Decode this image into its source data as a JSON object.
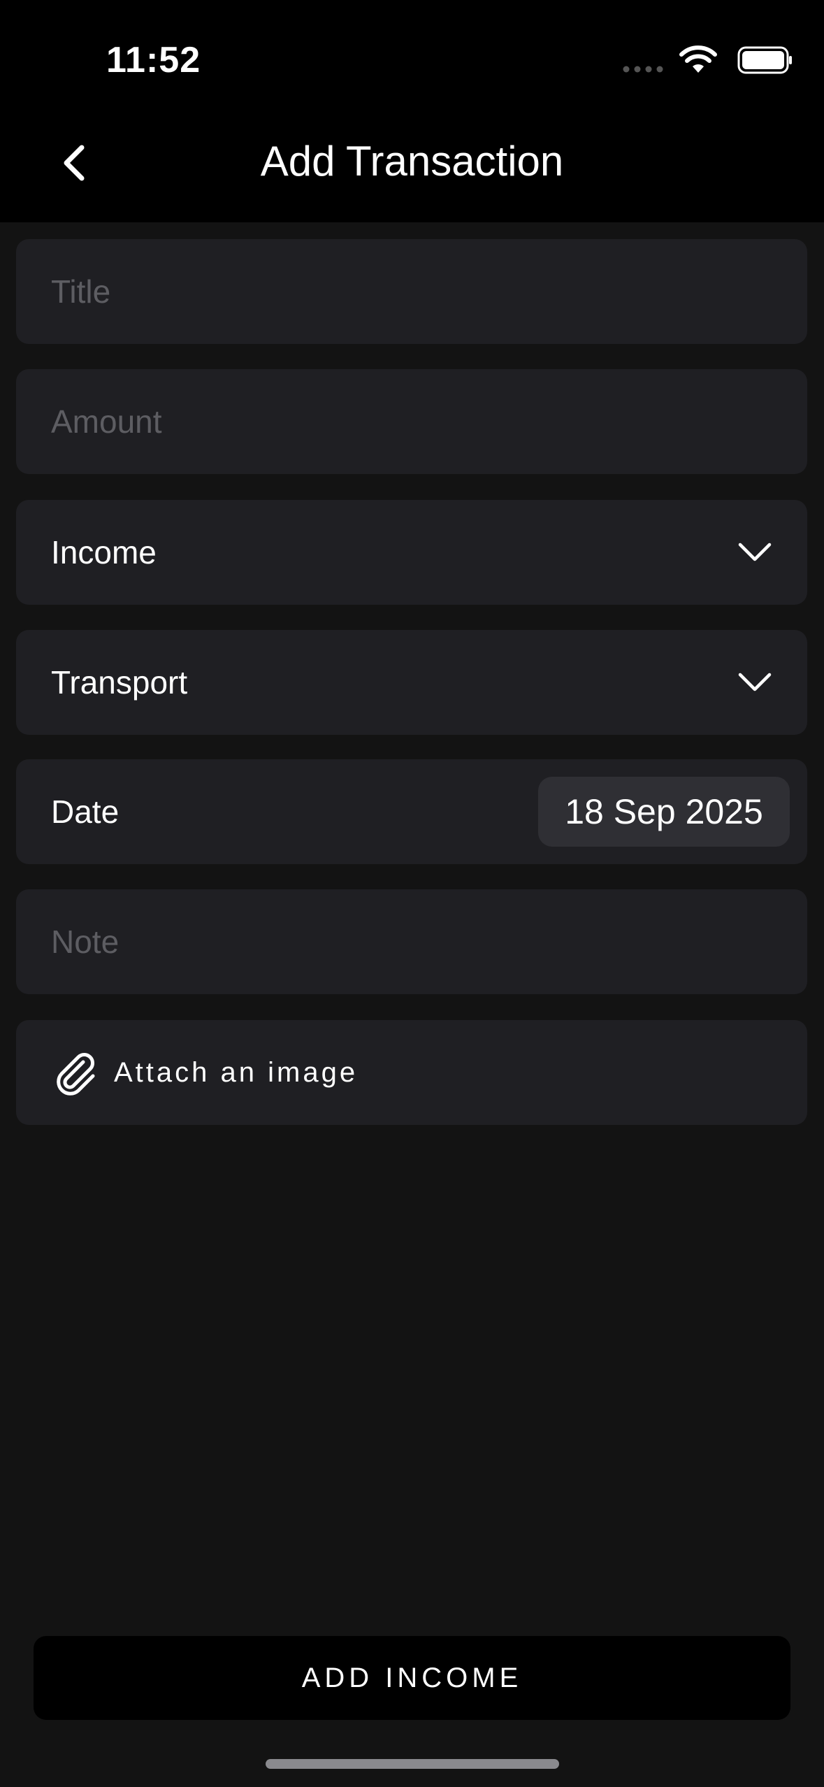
{
  "status_bar": {
    "time": "11:52",
    "icons": [
      "cellular-dots-icon",
      "wifi-icon",
      "battery-icon"
    ]
  },
  "nav": {
    "back_icon": "chevron-left-icon",
    "title": "Add Transaction"
  },
  "form": {
    "title_placeholder": "Title",
    "amount_placeholder": "Amount",
    "type_select": {
      "value": "Income",
      "icon": "chevron-down-icon"
    },
    "category_select": {
      "value": "Transport",
      "icon": "chevron-down-icon"
    },
    "date": {
      "label": "Date",
      "value": "18 Sep 2025"
    },
    "note_placeholder": "Note",
    "attach": {
      "icon": "paperclip-icon",
      "label": "Attach an image"
    }
  },
  "primary_action": {
    "label": "ADD INCOME"
  },
  "colors": {
    "background": "#131313",
    "header": "#000000",
    "field": "#1f1f23",
    "date_pill": "#2f2f34",
    "placeholder": "#5d5d62",
    "text": "#ffffff"
  }
}
